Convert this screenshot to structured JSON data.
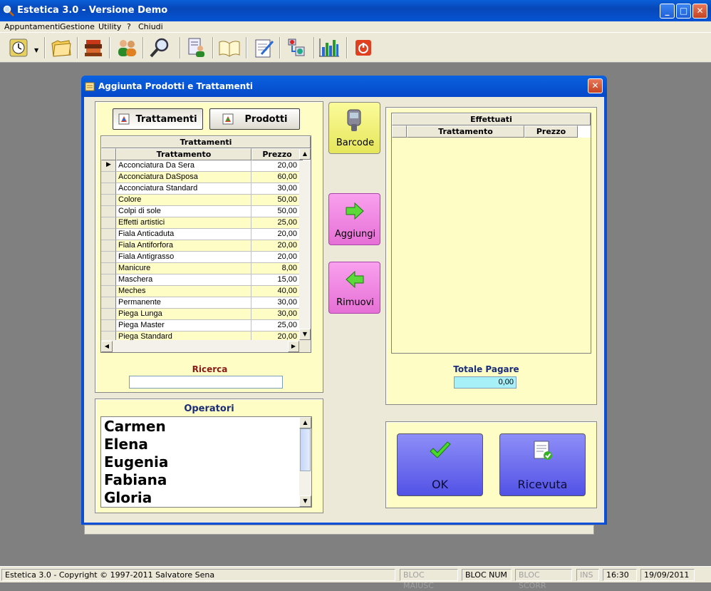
{
  "window": {
    "title": "Estetica 3.0 - Versione Demo",
    "app_icon": "magnifier-icon"
  },
  "menu": [
    "Appuntamenti",
    "Gestione",
    "Utility",
    "?",
    "Chiudi"
  ],
  "toolbar": [
    {
      "name": "clock-tool-button",
      "icon": "clock-icon"
    },
    {
      "name": "folder-tool-button",
      "icon": "folder-icon"
    },
    {
      "name": "products-tool-button",
      "icon": "bottles-icon"
    },
    {
      "name": "clients-tool-button",
      "icon": "people-icon"
    },
    {
      "name": "search-tool-button",
      "icon": "magnifier-icon"
    },
    {
      "name": "operator-tool-button",
      "icon": "person-list-icon"
    },
    {
      "name": "agenda-tool-button",
      "icon": "book-icon"
    },
    {
      "name": "document-tool-button",
      "icon": "document-edit-icon"
    },
    {
      "name": "backup-tool-button",
      "icon": "network-icon"
    },
    {
      "name": "statistics-tool-button",
      "icon": "bar-chart-icon"
    },
    {
      "name": "exit-tool-button",
      "icon": "power-icon"
    }
  ],
  "dialog": {
    "title": "Aggiunta Prodotti e Trattamenti",
    "tabs": {
      "treatments": "Trattamenti",
      "products": "Prodotti"
    },
    "left_grid": {
      "caption": "Trattamenti",
      "columns": [
        "Trattamento",
        "Prezzo"
      ],
      "rows": [
        [
          "Acconciatura Da Sera",
          "20,00"
        ],
        [
          "Acconciatura DaSposa",
          "60,00"
        ],
        [
          "Acconciatura Standard",
          "30,00"
        ],
        [
          "Colore",
          "50,00"
        ],
        [
          "Colpi di sole",
          "50,00"
        ],
        [
          "Effetti artistici",
          "25,00"
        ],
        [
          "Fiala Anticaduta",
          "20,00"
        ],
        [
          "Fiala Antiforfora",
          "20,00"
        ],
        [
          "Fiala Antigrasso",
          "20,00"
        ],
        [
          "Manicure",
          "8,00"
        ],
        [
          "Maschera",
          "15,00"
        ],
        [
          "Meches",
          "40,00"
        ],
        [
          "Permanente",
          "30,00"
        ],
        [
          "Piega Lunga",
          "30,00"
        ],
        [
          "Piega Master",
          "25,00"
        ],
        [
          "Piega Standard",
          "20,00"
        ]
      ]
    },
    "search": {
      "label": "Ricerca",
      "value": ""
    },
    "operators": {
      "label": "Operatori",
      "items": [
        "Carmen",
        "Elena",
        "Eugenia",
        "Fabiana",
        "Gloria"
      ]
    },
    "buttons": {
      "barcode": "Barcode",
      "add": "Aggiungi",
      "remove": "Rimuovi",
      "ok": "OK",
      "receipt": "Ricevuta"
    },
    "right_grid": {
      "caption": "Effettuati",
      "columns": [
        "Trattamento",
        "Prezzo"
      ]
    },
    "total": {
      "label": "Totale Pagare",
      "value": "0,00"
    }
  },
  "status": {
    "copyright": "Estetica 3.0 - Copyright © 1997-2011 Salvatore Sena",
    "caps": "BLOC MAIUSC",
    "num": "BLOC NUM",
    "scroll": "BLOC SCORR",
    "ins": "INS",
    "time": "16:30",
    "date": "19/09/2011"
  },
  "colors": {
    "panel": "#fffdc6",
    "green_button": "#f0f07a",
    "magenta_button": "#f07ae0",
    "blue_button": "#6a6af2",
    "total_field": "#a8f0f8"
  }
}
